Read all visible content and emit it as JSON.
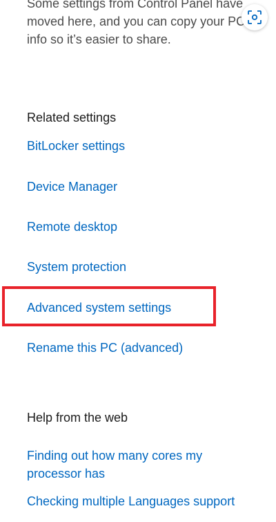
{
  "intro": {
    "text": "Some settings from Control Panel have moved here, and you can copy your PC info so it’s easier to share."
  },
  "related": {
    "title": "Related settings",
    "links": [
      "BitLocker settings",
      "Device Manager",
      "Remote desktop",
      "System protection",
      "Advanced system settings",
      "Rename this PC (advanced)"
    ]
  },
  "help": {
    "title": "Help from the web",
    "links": [
      "Finding out how many cores my processor has",
      "Checking multiple Languages support"
    ]
  },
  "colors": {
    "link": "#0067c0",
    "highlight": "#e8222a"
  },
  "icons": {
    "lens": "visual-search-icon"
  }
}
